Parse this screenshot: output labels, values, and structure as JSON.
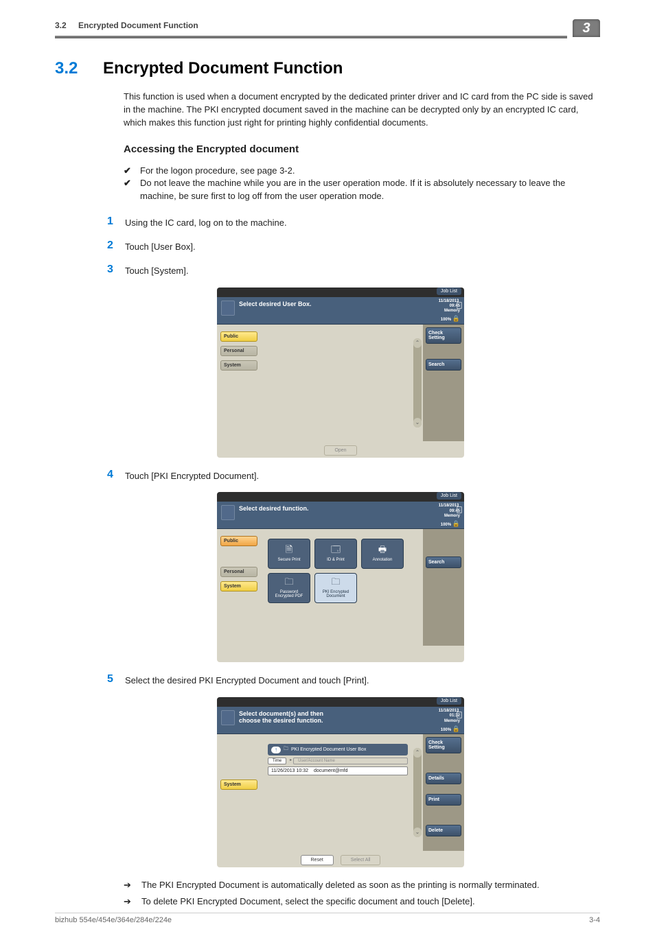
{
  "header": {
    "section_no": "3.2",
    "section_title": "Encrypted Document Function",
    "tab_no": "3"
  },
  "heading": {
    "num": "3.2",
    "title": "Encrypted Document Function"
  },
  "intro": "This function is used when a document encrypted by the dedicated printer driver and IC card from the PC side is saved in the machine. The PKI encrypted document saved in the machine can be decrypted only by an encrypted IC card, which makes this function just right for printing highly confidential documents.",
  "subheading": "Accessing the Encrypted document",
  "checks": [
    "For the logon procedure, see page 3-2.",
    "Do not leave the machine while you are in the user operation mode. If it is absolutely necessary to leave the machine, be sure first to log off from the user operation mode."
  ],
  "steps": [
    {
      "n": "1",
      "t": "Using the IC card, log on to the machine."
    },
    {
      "n": "2",
      "t": "Touch [User Box]."
    },
    {
      "n": "3",
      "t": "Touch [System]."
    },
    {
      "n": "4",
      "t": "Touch [PKI Encrypted Document]."
    },
    {
      "n": "5",
      "t": "Select the desired PKI Encrypted Document and touch [Print]."
    }
  ],
  "arrows": [
    "The PKI Encrypted Document is automatically deleted as soon as the printing is normally terminated.",
    "To delete PKI Encrypted Document, select the specific document and touch [Delete]."
  ],
  "ui_common": {
    "job_list": "Job List",
    "date": "11/18/2013",
    "time": "09:45",
    "time3": "01:32",
    "memory": "Memory",
    "mempct": "100%",
    "tabs": {
      "public": "Public",
      "personal": "Personal",
      "system": "System"
    }
  },
  "shot1": {
    "title": "Select desired User Box.",
    "right": {
      "check": "Check Setting",
      "search": "Search"
    },
    "open": "Open"
  },
  "shot2": {
    "title": "Select desired function.",
    "right": {
      "search": "Search"
    },
    "tiles": [
      {
        "label": "Secure Print"
      },
      {
        "label": "ID & Print"
      },
      {
        "label": "Annotation"
      },
      {
        "label": "Password\nEncrypted PDF"
      },
      {
        "label": "PKI Encrypted\nDocument"
      }
    ]
  },
  "shot3": {
    "title": "Select document(s) and then\nchoose the desired function.",
    "crumb": "PKI Encrypted Document User Box",
    "col_a": "Time",
    "col_b": "User/Account Name",
    "row_time": "11/26/2013 10:32",
    "row_user": "document@mfd",
    "right": {
      "check": "Check Setting",
      "details": "Details",
      "print": "Print",
      "delete": "Delete"
    },
    "bottom": {
      "reset": "Reset",
      "select_all": "Select All"
    }
  },
  "footer": {
    "left": "bizhub 554e/454e/364e/284e/224e",
    "right": "3-4"
  }
}
